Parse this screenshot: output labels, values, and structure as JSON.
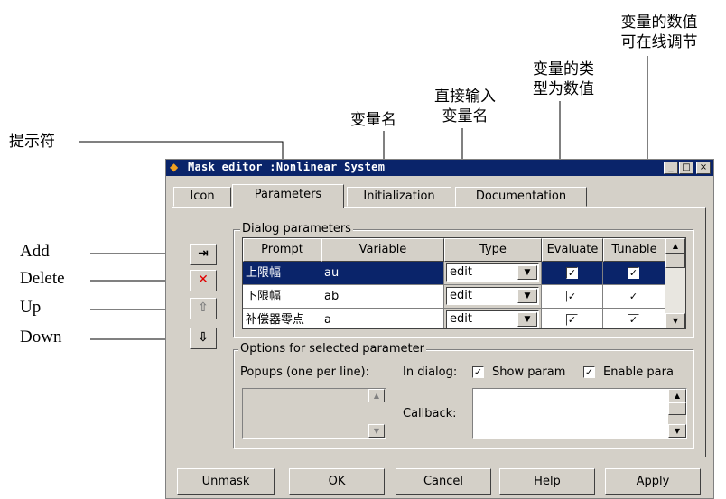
{
  "annotations": {
    "prompt_cn": "提示符",
    "variable_cn": "变量名",
    "type_cn_1": "直接输入",
    "type_cn_2": "变量名",
    "evaluate_cn_1": "变量的类",
    "evaluate_cn_2": "型为数值",
    "tunable_cn_1": "变量的数值",
    "tunable_cn_2": "可在线调节",
    "add": "Add",
    "delete": "Delete",
    "up": "Up",
    "down": "Down"
  },
  "window": {
    "title": "Mask editor :Nonlinear System",
    "minimize": "_",
    "maximize": "□",
    "close": "×"
  },
  "tabs": [
    "Icon",
    "Parameters",
    "Initialization",
    "Documentation"
  ],
  "dialog_params": {
    "legend": "Dialog parameters",
    "headers": [
      "Prompt",
      "Variable",
      "Type",
      "Evaluate",
      "Tunable"
    ],
    "rows": [
      {
        "prompt": "上限幅",
        "variable": "au",
        "type": "edit",
        "evaluate": true,
        "tunable": true
      },
      {
        "prompt": "下限幅",
        "variable": "ab",
        "type": "edit",
        "evaluate": true,
        "tunable": true
      },
      {
        "prompt": "补偿器零点",
        "variable": "a",
        "type": "edit",
        "evaluate": true,
        "tunable": true
      }
    ]
  },
  "side_buttons": {
    "add": "⇥",
    "delete": "✕",
    "up": "⇧",
    "down": "⇩"
  },
  "options": {
    "legend": "Options for selected parameter",
    "popups_label": "Popups (one per line):",
    "in_dialog_label": "In dialog:",
    "show_param": "Show param",
    "enable_param": "Enable para",
    "callback_label": "Callback:"
  },
  "buttons": [
    "Unmask",
    "OK",
    "Cancel",
    "Help",
    "Apply"
  ]
}
